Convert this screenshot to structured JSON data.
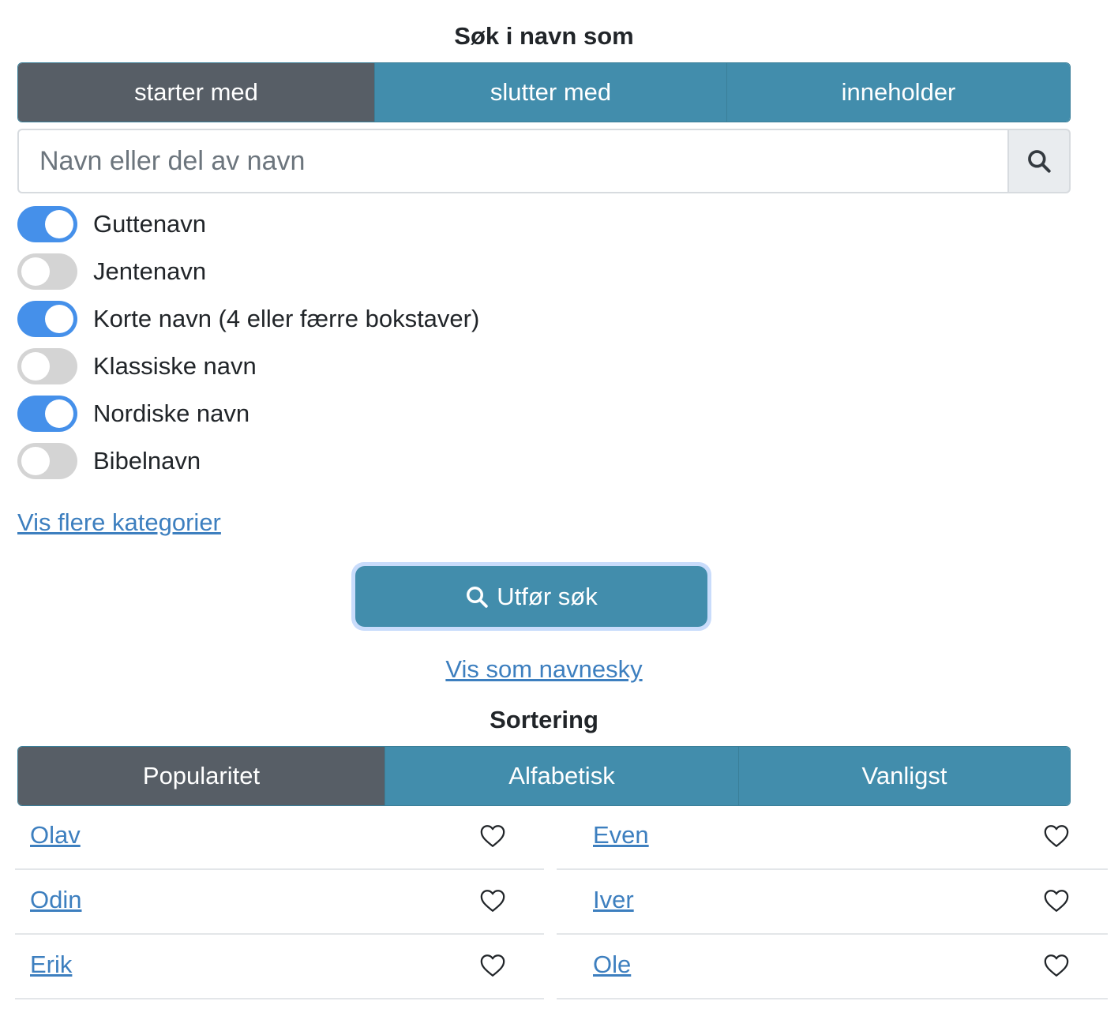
{
  "search": {
    "heading": "Søk i navn som",
    "modes": [
      {
        "label": "starter med",
        "active": true
      },
      {
        "label": "slutter med",
        "active": false
      },
      {
        "label": "inneholder",
        "active": false
      }
    ],
    "input_placeholder": "Navn eller del av navn",
    "input_value": ""
  },
  "filters": [
    {
      "label": "Guttenavn",
      "on": true
    },
    {
      "label": "Jentenavn",
      "on": false
    },
    {
      "label": "Korte navn (4 eller færre bokstaver)",
      "on": true
    },
    {
      "label": "Klassiske navn",
      "on": false
    },
    {
      "label": "Nordiske navn",
      "on": true
    },
    {
      "label": "Bibelnavn",
      "on": false
    }
  ],
  "more_categories_link": "Vis flere kategorier",
  "submit_label": "Utfør søk",
  "cloud_link": "Vis som navnesky",
  "sorting": {
    "heading": "Sortering",
    "options": [
      {
        "label": "Popularitet",
        "active": true
      },
      {
        "label": "Alfabetisk",
        "active": false
      },
      {
        "label": "Vanligst",
        "active": false
      }
    ]
  },
  "results": {
    "left": [
      "Olav",
      "Odin",
      "Erik"
    ],
    "right": [
      "Even",
      "Iver",
      "Ole"
    ]
  },
  "colors": {
    "segment_active": "#575e66",
    "segment": "#428dac",
    "switch_on": "#4590ea",
    "switch_off": "#d4d4d4",
    "link": "#3d7fbf"
  }
}
